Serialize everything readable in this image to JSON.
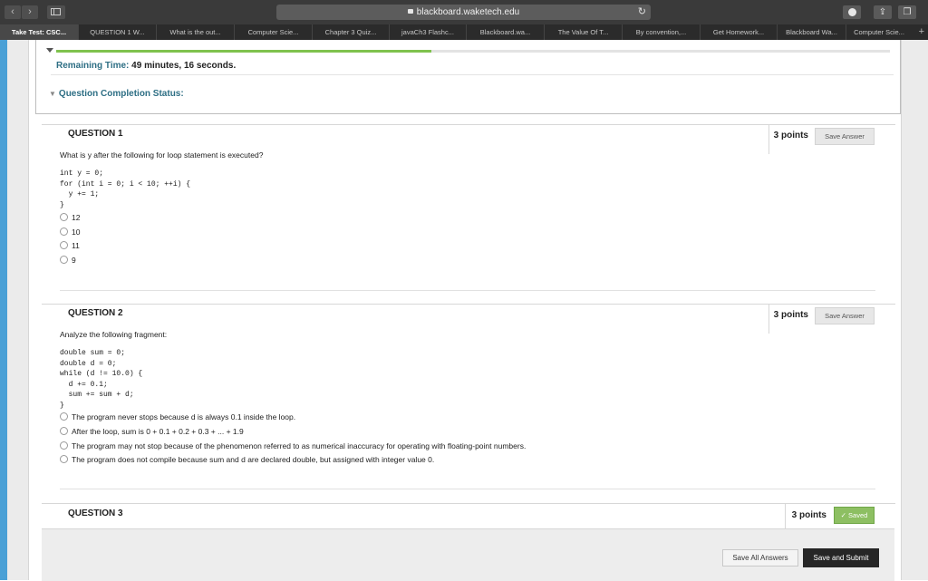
{
  "browser": {
    "url": "blackboard.waketech.edu",
    "tabs": [
      {
        "label": "Take Test: CSC...",
        "active": true
      },
      {
        "label": "QUESTION 1 W..."
      },
      {
        "label": "What is the out..."
      },
      {
        "label": "Computer Scie..."
      },
      {
        "label": "Chapter 3 Quiz..."
      },
      {
        "label": "javaCh3 Flashc..."
      },
      {
        "label": "Blackboard.wa..."
      },
      {
        "label": "The Value Of T..."
      },
      {
        "label": "By convention,..."
      },
      {
        "label": "Get Homework..."
      },
      {
        "label": "Blackboard Wa..."
      },
      {
        "label": "Computer Scie..."
      }
    ],
    "new_tab_symbol": "+"
  },
  "status": {
    "progress_fraction": 0.45,
    "remaining_label": "Remaining Time:",
    "remaining_value": "49 minutes, 16 seconds.",
    "completion_label": "Question Completion Status:"
  },
  "questions": [
    {
      "title": "QUESTION 1",
      "points": "3 points",
      "save_label": "Save Answer",
      "text": "What is y after the following for loop statement is executed?",
      "code": "int y = 0;\nfor (int i = 0; i < 10; ++i) {\n  y += 1;\n}",
      "options": [
        "12",
        "10",
        "11",
        "9"
      ]
    },
    {
      "title": "QUESTION 2",
      "points": "3 points",
      "save_label": "Save Answer",
      "text": "Analyze the following fragment:",
      "code": "double sum = 0;\ndouble d = 0;\nwhile (d != 10.0) {\n  d += 0.1;\n  sum += sum + d;\n}",
      "options": [
        "The program never stops because d is always 0.1 inside the loop.",
        "After the loop, sum is 0 + 0.1 + 0.2 + 0.3 + ... + 1.9",
        "The program may not stop because of the phenomenon referred to as numerical inaccuracy for operating with floating-point numbers.",
        "The program does not compile because sum and d are declared double, but assigned with integer value 0."
      ]
    },
    {
      "title": "QUESTION 3",
      "points": "3 points",
      "saved_label": "Saved"
    }
  ],
  "footer": {
    "save_all_label": "Save All Answers",
    "save_submit_label": "Save and Submit"
  },
  "colors": {
    "accent_blue": "#4aa0d6",
    "progress_green": "#7fc24e",
    "label_teal": "#2d6e84",
    "saved_green": "#8dbf62"
  }
}
